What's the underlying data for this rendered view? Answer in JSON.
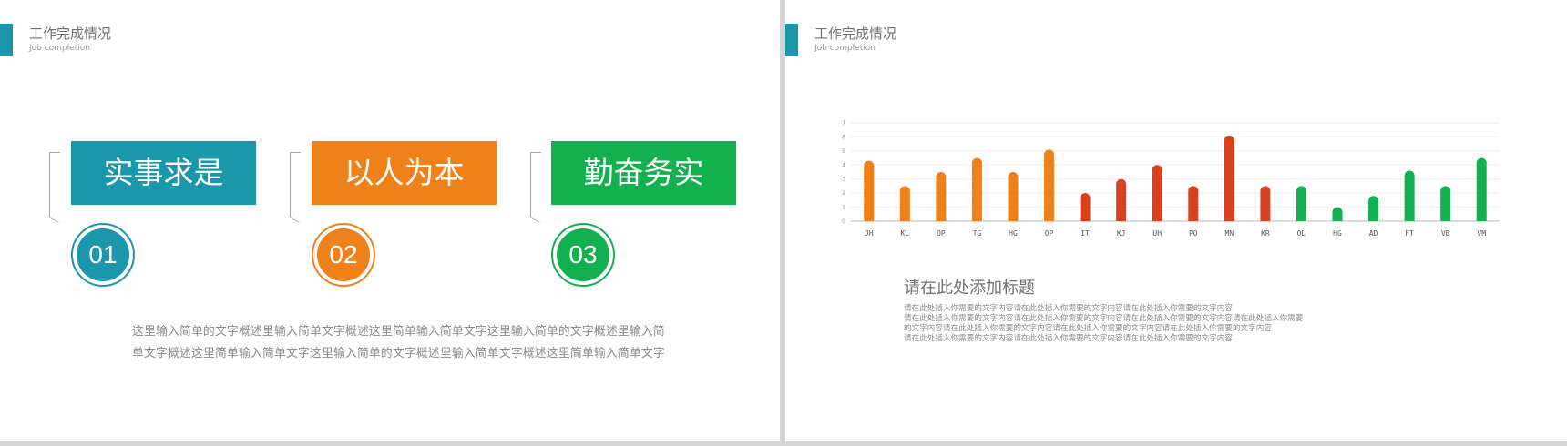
{
  "left_slide": {
    "header": {
      "title": "工作完成情况",
      "subtitle": "Job completion"
    },
    "cards": [
      {
        "label": "实事求是",
        "number": "01",
        "color": "#1a97aa"
      },
      {
        "label": "以人为本",
        "number": "02",
        "color": "#ee8119"
      },
      {
        "label": "勤奋务实",
        "number": "03",
        "color": "#12b04e"
      }
    ],
    "description": "这里输入简单的文字概述里输入简单文字概述这里简单输入简单文字这里输入简单的文字概述里输入简单文字概述这里简单输入简单文字这里输入简单的文字概述里输入简单文字概述这里简单输入简单文字"
  },
  "right_slide": {
    "header": {
      "title": "工作完成情况",
      "subtitle": "Job completion"
    },
    "heading": "请在此处添加标题",
    "paragraph_lines": [
      "请在此处插入你需要的文字内容请在此处插入你需要的文字内容请在此处插入你需要的文字内容",
      "请在此处插入你需要的文字内容请在此处插入你需要的文字内容请在此处插入你需要的文字内容请在此处插入你需要",
      "的文字内容请在此处插入你需要的文字内容请在此处插入你需要的文字内容请在此处插入你需要的文字内容",
      "请在此处插入你需要的文字内容请在此处插入你需要的文字内容请在此处插入你需要的文字内容"
    ]
  },
  "chart_data": {
    "type": "bar",
    "categories": [
      "JH",
      "KL",
      "OP",
      "TG",
      "HG",
      "OP",
      "IT",
      "KJ",
      "UH",
      "PO",
      "MN",
      "KR",
      "OL",
      "HG",
      "AD",
      "FT",
      "VB",
      "VM"
    ],
    "values": [
      4.3,
      2.5,
      3.5,
      4.5,
      3.5,
      5.1,
      2.0,
      3.0,
      4.0,
      2.5,
      6.1,
      2.5,
      2.5,
      1.0,
      1.8,
      3.6,
      2.5,
      4.5
    ],
    "bar_colors": [
      "#ee8119",
      "#ee8119",
      "#ee8119",
      "#ee8119",
      "#ee8119",
      "#ee8119",
      "#d9411e",
      "#d9411e",
      "#d9411e",
      "#d9411e",
      "#d9411e",
      "#d9411e",
      "#12b04e",
      "#12b04e",
      "#12b04e",
      "#12b04e",
      "#12b04e",
      "#12b04e"
    ],
    "yticks": [
      0,
      1,
      2,
      3,
      4,
      5,
      6,
      7
    ],
    "ylim": [
      0,
      7
    ],
    "grid": true,
    "title": "",
    "xlabel": "",
    "ylabel": ""
  }
}
